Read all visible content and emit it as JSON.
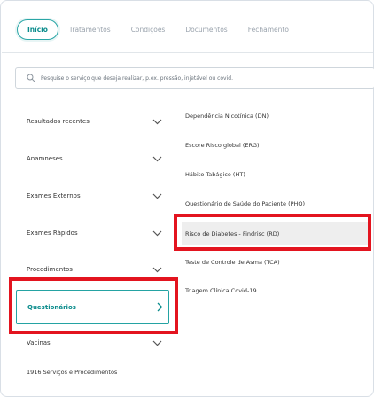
{
  "tabs": [
    {
      "label": "Início",
      "active": true
    },
    {
      "label": "Tratamentos",
      "active": false
    },
    {
      "label": "Condições",
      "active": false
    },
    {
      "label": "Documentos",
      "active": false
    },
    {
      "label": "Fechamento",
      "active": false
    }
  ],
  "search": {
    "placeholder": "Pesquise o serviço que deseja realizar, p.ex. pressão, injetável ou covid."
  },
  "categories": [
    {
      "label": "Resultados recentes",
      "icon": "chevron-down-icon"
    },
    {
      "label": "Anamneses",
      "icon": "chevron-down-icon"
    },
    {
      "label": "Exames Externos",
      "icon": "chevron-down-icon"
    },
    {
      "label": "Exames Rápidos",
      "icon": "chevron-down-icon"
    },
    {
      "label": "Procedimentos",
      "icon": "chevron-down-icon"
    },
    {
      "label": "Questionários",
      "icon": "chevron-right-icon",
      "selected": true
    },
    {
      "label": "Vacinas",
      "icon": "chevron-down-icon"
    }
  ],
  "footer": {
    "count_label": "1916 Serviços e Procedimentos"
  },
  "services": [
    {
      "label": "Dependência Nicotínica (DN)"
    },
    {
      "label": "Escore Risco global (ERG)"
    },
    {
      "label": "Hábito Tabágico (HT)"
    },
    {
      "label": "Questionário de Saúde do Paciente (PHQ)"
    },
    {
      "label": "Risco de Diabetes - Findrisc (RD)",
      "selected": true
    },
    {
      "label": "Teste de Controle de Asma (TCA)"
    },
    {
      "label": "Triagem Clínica Covid-19"
    }
  ],
  "colors": {
    "accent": "#0b8c8c",
    "accent_border": "#24a3a3",
    "highlight": "#e3141f",
    "selected_row_bg": "#eeeeee"
  }
}
